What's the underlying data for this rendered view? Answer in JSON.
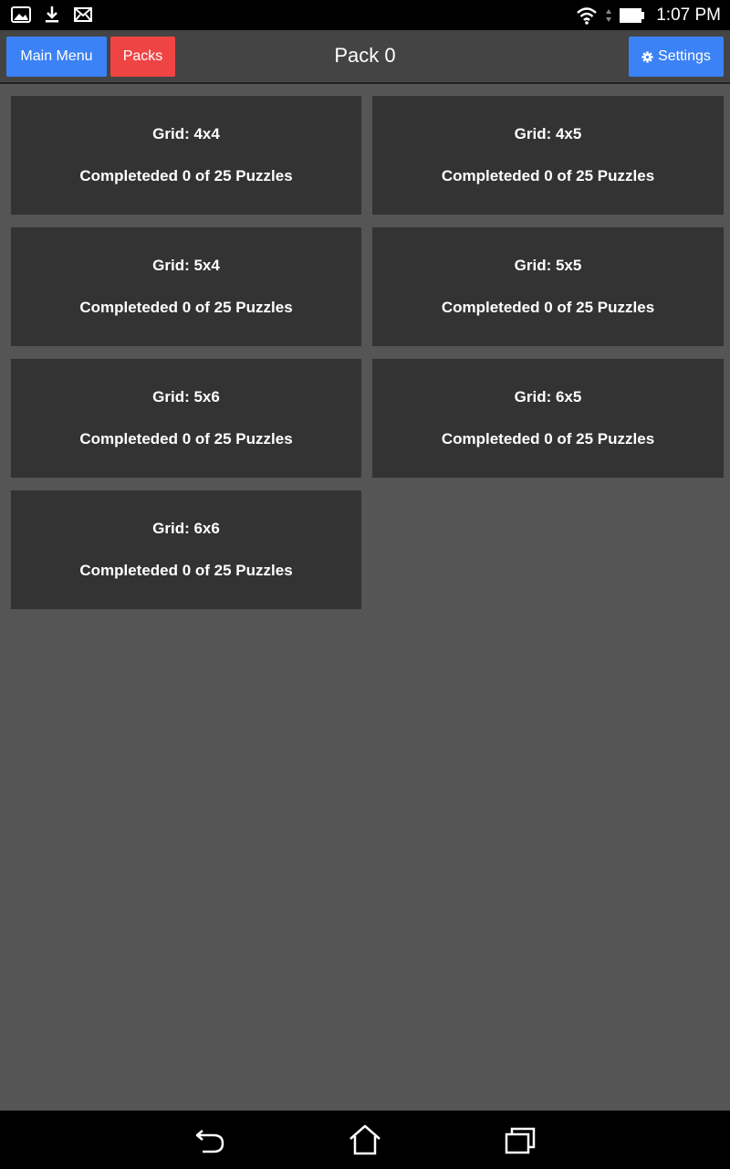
{
  "status_bar": {
    "time": "1:07 PM",
    "icons": [
      "gallery-icon",
      "download-icon",
      "mail-icon",
      "wifi-icon",
      "signal-icon",
      "battery-icon"
    ]
  },
  "app_bar": {
    "main_menu_label": "Main Menu",
    "packs_label": "Packs",
    "title": "Pack 0",
    "settings_label": "Settings",
    "colors": {
      "blue": "#3b82f6",
      "red": "#ef4444"
    }
  },
  "packs": [
    {
      "grid": "Grid: 4x4",
      "progress": "Completeded 0 of 25 Puzzles"
    },
    {
      "grid": "Grid: 4x5",
      "progress": "Completeded 0 of 25 Puzzles"
    },
    {
      "grid": "Grid: 5x4",
      "progress": "Completeded 0 of 25 Puzzles"
    },
    {
      "grid": "Grid: 5x5",
      "progress": "Completeded 0 of 25 Puzzles"
    },
    {
      "grid": "Grid: 5x6",
      "progress": "Completeded 0 of 25 Puzzles"
    },
    {
      "grid": "Grid: 6x5",
      "progress": "Completeded 0 of 25 Puzzles"
    },
    {
      "grid": "Grid: 6x6",
      "progress": "Completeded 0 of 25 Puzzles"
    }
  ],
  "nav_bar": {
    "icons": [
      "back-icon",
      "home-icon",
      "recents-icon"
    ]
  }
}
